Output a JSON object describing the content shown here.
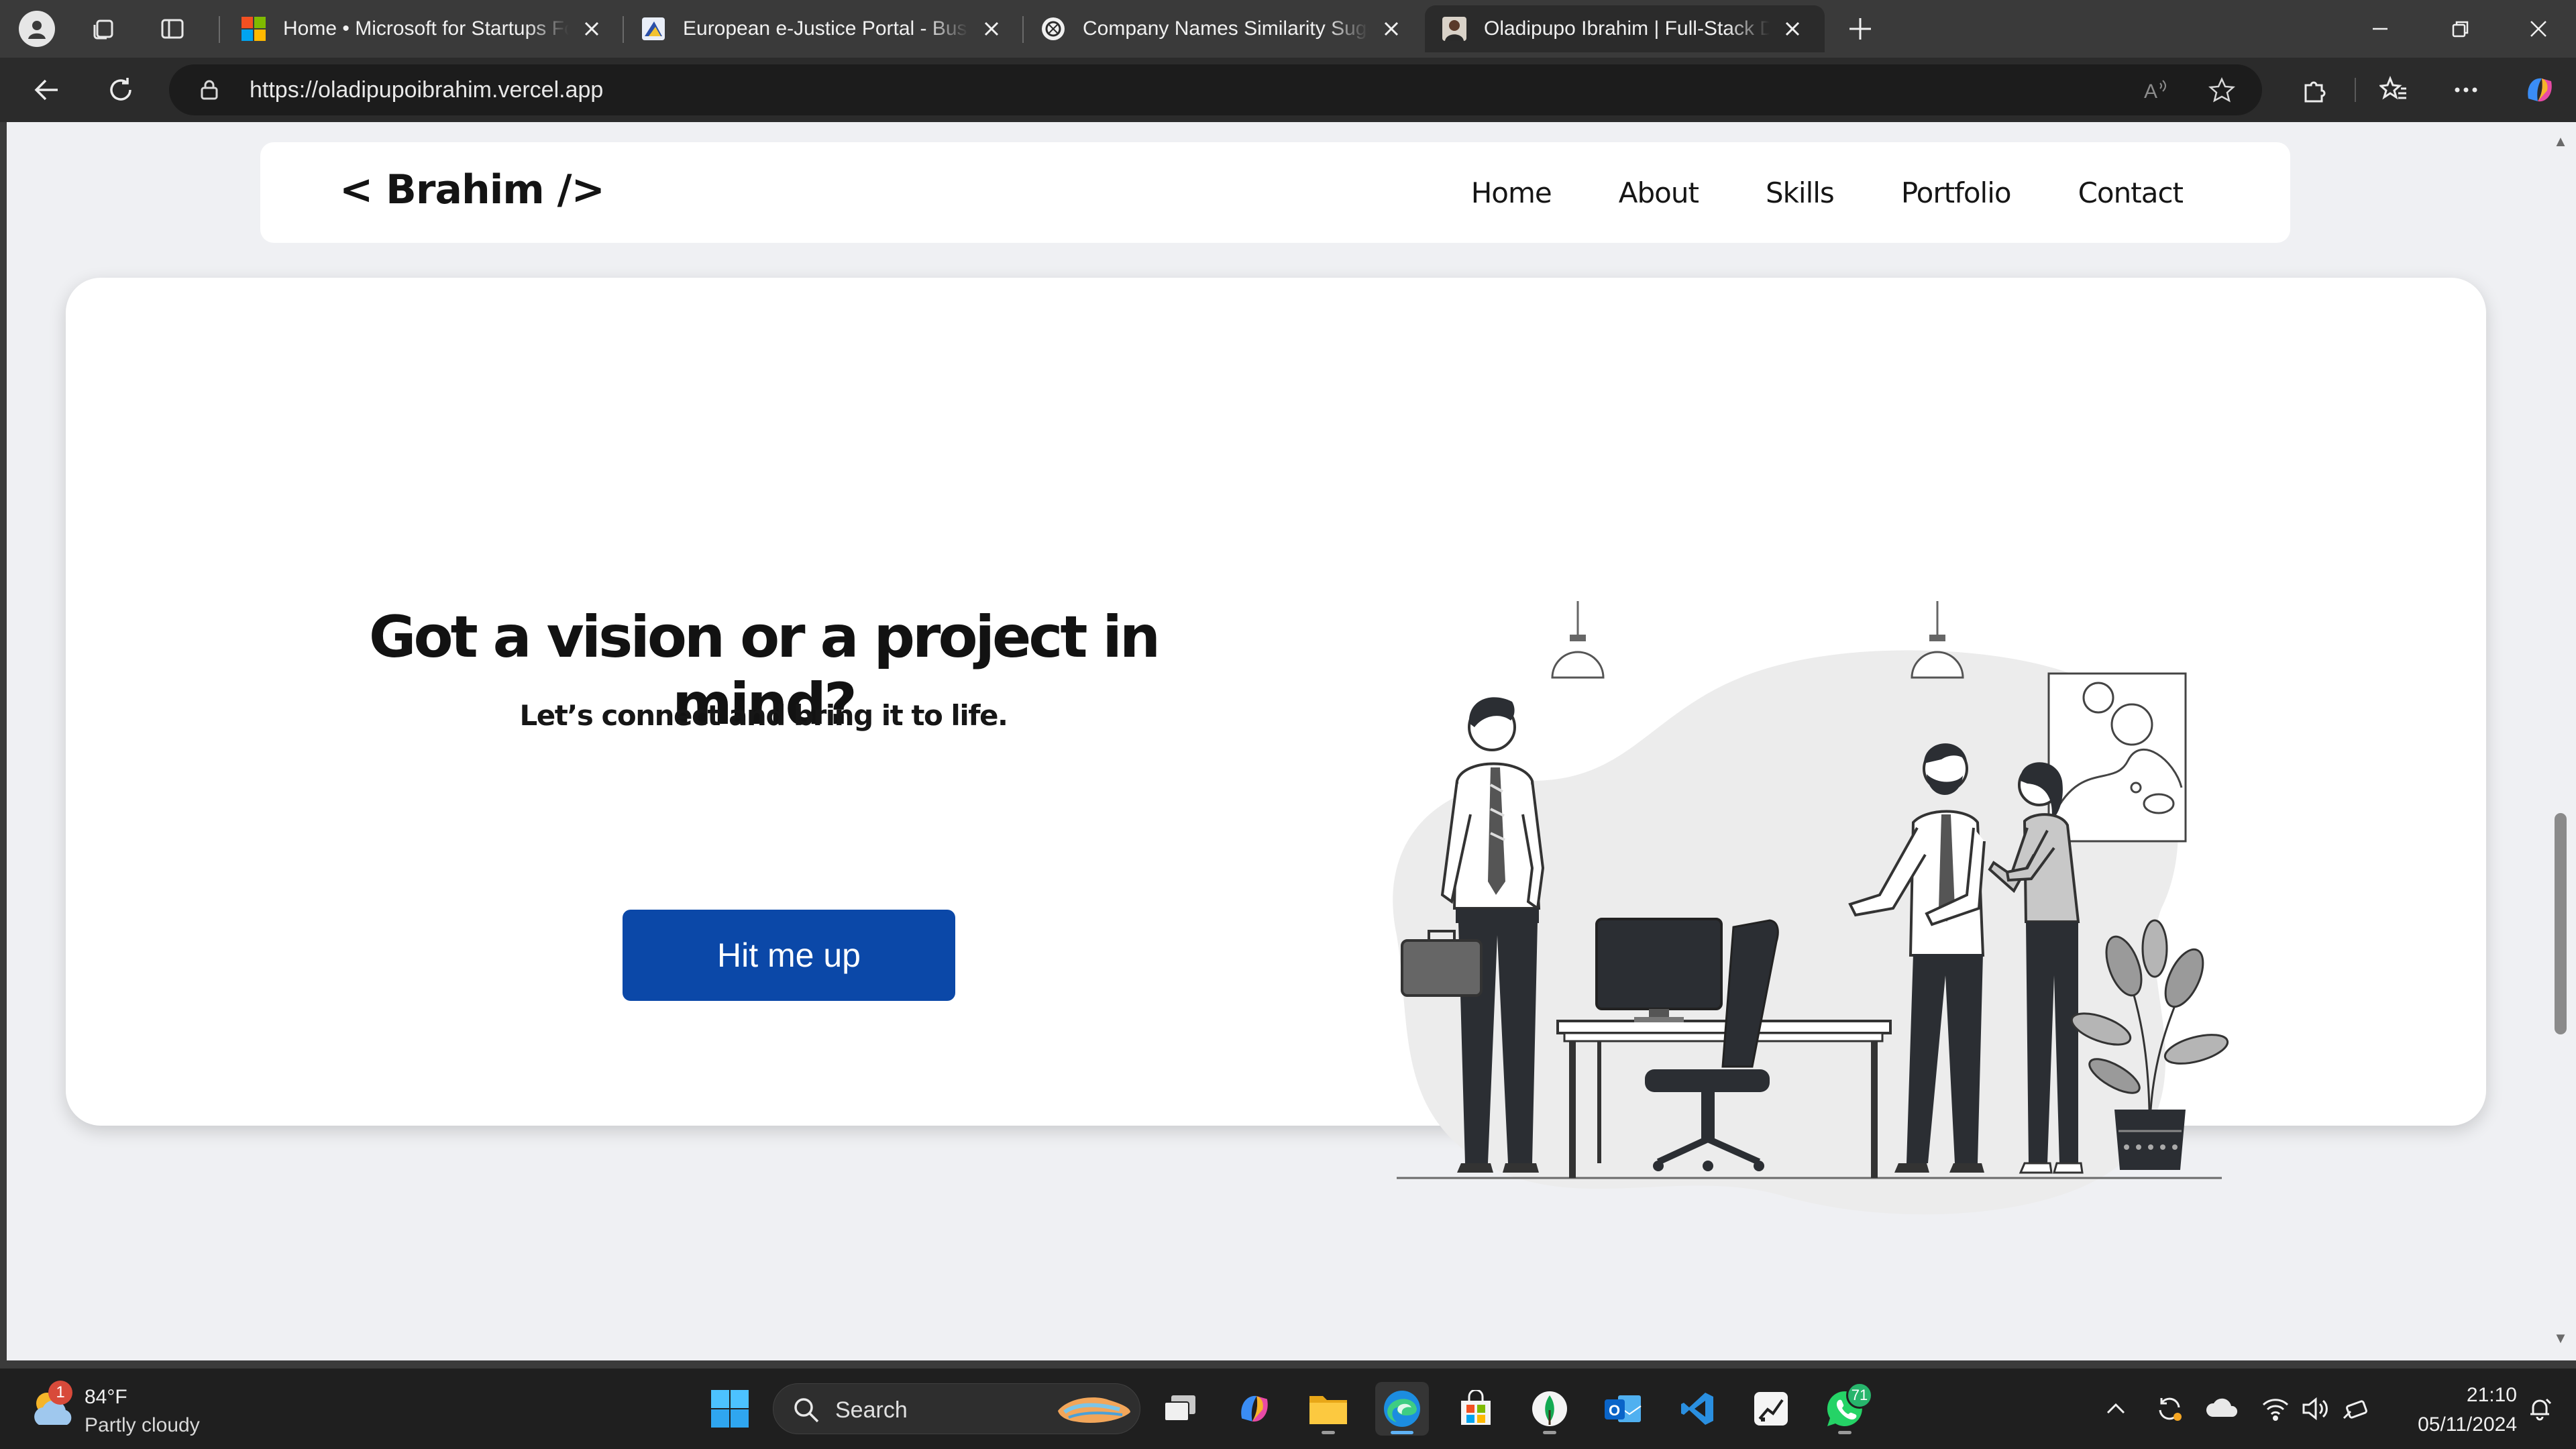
{
  "browser": {
    "tabs": [
      {
        "title": "Home • Microsoft for Startups Founders Hub",
        "active": false
      },
      {
        "title": "European e-Justice Portal - Business registers",
        "active": false
      },
      {
        "title": "Company Names Similarity Suggestions",
        "active": false
      },
      {
        "title": "Oladipupo Ibrahim | Full-Stack Developer",
        "active": true
      }
    ],
    "url": "https://oladipupoibrahim.vercel.app"
  },
  "site": {
    "logo": "< Brahim />",
    "nav": [
      "Home",
      "About",
      "Skills",
      "Portfolio",
      "Contact"
    ],
    "hero": {
      "heading": "Got a vision or a project in mind?",
      "subheading": "Let’s connect and bring it to life.",
      "cta": "Hit me up"
    }
  },
  "taskbar": {
    "weather": {
      "temp": "84°F",
      "condition": "Partly cloudy",
      "badge": "1"
    },
    "search_placeholder": "Search",
    "whatsapp_badge": "71",
    "time": "21:10",
    "date": "05/11/2024"
  },
  "colors": {
    "accent": "#0b48a8",
    "page_bg": "#eff0f3"
  }
}
